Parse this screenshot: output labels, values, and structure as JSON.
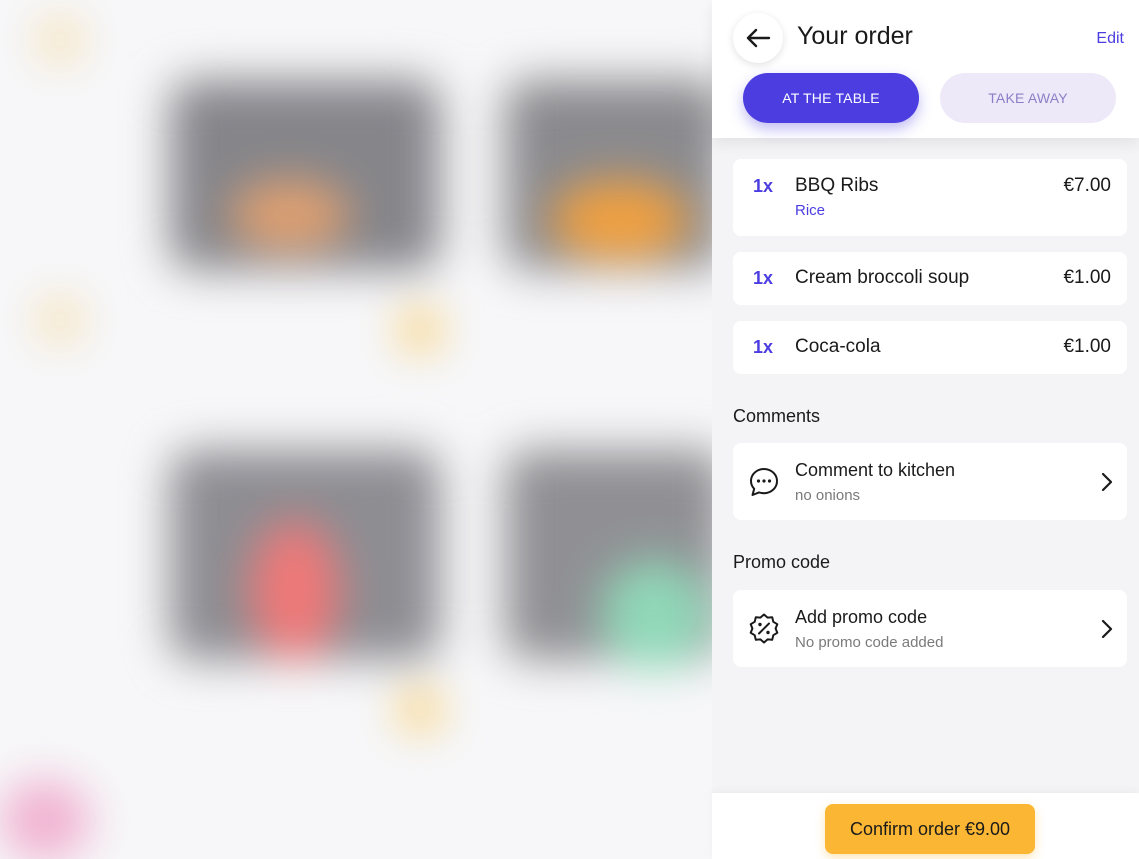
{
  "header": {
    "title": "Your order",
    "edit_label": "Edit",
    "mode_at_table": "AT THE TABLE",
    "mode_take_away": "TAKE AWAY"
  },
  "items": [
    {
      "qty": "1x",
      "name": "BBQ Ribs",
      "price": "€7.00",
      "modifier": "Rice"
    },
    {
      "qty": "1x",
      "name": "Cream broccoli soup",
      "price": "€1.00"
    },
    {
      "qty": "1x",
      "name": "Coca-cola",
      "price": "€1.00"
    }
  ],
  "comments": {
    "section_label": "Comments",
    "title": "Comment to kitchen",
    "value": "no onions",
    "icon": "chat-bubble-icon"
  },
  "promo": {
    "section_label": "Promo code",
    "title": "Add promo code",
    "value": "No promo code added",
    "icon": "discount-badge-icon"
  },
  "footer": {
    "confirm_label": "Confirm order €9.00"
  },
  "colors": {
    "accent": "#4b3de0",
    "confirm": "#fbb634"
  }
}
